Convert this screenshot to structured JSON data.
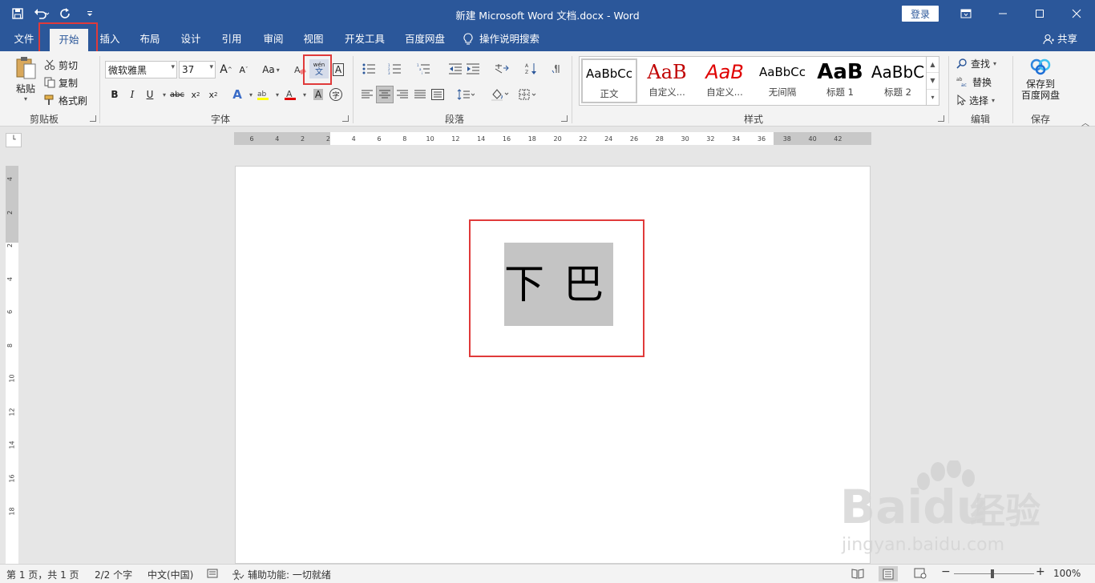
{
  "titlebar": {
    "title": "新建 Microsoft Word 文档.docx  -  Word",
    "login": "登录"
  },
  "tabs": [
    "文件",
    "开始",
    "插入",
    "布局",
    "设计",
    "引用",
    "审阅",
    "视图",
    "开发工具",
    "百度网盘"
  ],
  "active_tab": "开始",
  "tellme": "操作说明搜索",
  "share": "共享",
  "clipboard": {
    "paste": "粘贴",
    "cut": "剪切",
    "copy": "复制",
    "format_painter": "格式刷",
    "label": "剪贴板"
  },
  "font": {
    "name": "微软雅黑",
    "size": "37",
    "label": "字体",
    "aa": "Aa",
    "pinyin_top": "wén",
    "pinyin_char": "文"
  },
  "paragraph": {
    "label": "段落"
  },
  "styles": {
    "label": "样式",
    "items": [
      {
        "sample": "AaBbCc",
        "name": "正文",
        "color": "#000000"
      },
      {
        "sample": "AaB",
        "name": "自定义...",
        "color": "#c00000"
      },
      {
        "sample": "AaB",
        "name": "自定义...",
        "color": "#e00000"
      },
      {
        "sample": "AaBbCc",
        "name": "无间隔",
        "color": "#000000"
      },
      {
        "sample": "AaB",
        "name": "标题 1",
        "color": "#000000"
      },
      {
        "sample": "AaBbC",
        "name": "标题 2",
        "color": "#000000"
      }
    ]
  },
  "editing": {
    "find": "查找",
    "replace": "替换",
    "select": "选择",
    "label": "编辑"
  },
  "save": {
    "button": "保存到\n百度网盘",
    "line1": "保存到",
    "line2": "百度网盘",
    "label": "保存"
  },
  "hruler_ticks": [
    "6",
    "4",
    "2",
    "2",
    "4",
    "6",
    "8",
    "10",
    "12",
    "14",
    "16",
    "18",
    "20",
    "22",
    "24",
    "26",
    "28",
    "30",
    "32",
    "34",
    "36",
    "38",
    "40",
    "42"
  ],
  "vruler_ticks": [
    "4",
    "2",
    "2",
    "4",
    "6",
    "8",
    "10",
    "12",
    "14",
    "16",
    "18"
  ],
  "document": {
    "chars": [
      "下",
      "巴"
    ]
  },
  "status": {
    "page": "第 1 页，共 1 页",
    "words": "2/2 个字",
    "lang": "中文(中国)",
    "accessibility": "辅助功能: 一切就绪",
    "zoom": "100%"
  },
  "watermark": {
    "brand": "Baidu",
    "cn": "经验",
    "url": "jingyan.baidu.com"
  }
}
